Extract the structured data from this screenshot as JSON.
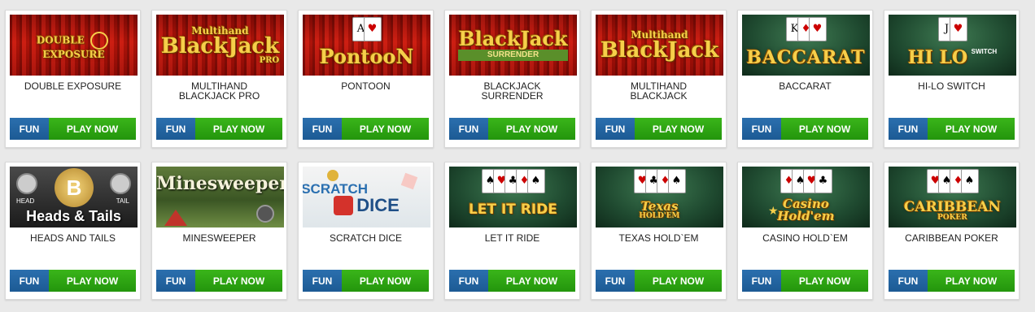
{
  "buttons": {
    "fun": "FUN",
    "play": "PLAY NOW"
  },
  "games": [
    {
      "title": "DOUBLE EXPOSURE",
      "logo_lines": [
        "DOUBLE",
        "EXPOSURE"
      ]
    },
    {
      "title": "MULTIHAND\nBLACKJACK PRO",
      "logo_lines": [
        "Multihand",
        "BlackJack",
        "PRO"
      ]
    },
    {
      "title": "PONTOON",
      "logo_lines": [
        "PontooN"
      ]
    },
    {
      "title": "BLACKJACK\nSURRENDER",
      "logo_lines": [
        "BlackJack",
        "SURRENDER"
      ]
    },
    {
      "title": "MULTIHAND\nBLACKJACK",
      "logo_lines": [
        "Multihand",
        "BlackJack"
      ]
    },
    {
      "title": "BACCARAT",
      "logo_lines": [
        "BACCARAT"
      ]
    },
    {
      "title": "HI-LO SWITCH",
      "logo_lines": [
        "HI LO",
        "SWITCH"
      ]
    },
    {
      "title": "HEADS AND TAILS",
      "logo_lines": [
        "Heads & Tails",
        "HEAD",
        "TAIL"
      ]
    },
    {
      "title": "MINESWEEPER",
      "logo_lines": [
        "Minesweeper"
      ]
    },
    {
      "title": "SCRATCH DICE",
      "logo_lines": [
        "SCRATCH",
        "DICE"
      ]
    },
    {
      "title": "LET IT RIDE",
      "logo_lines": [
        "LET IT RIDE"
      ]
    },
    {
      "title": "TEXAS HOLD`EM",
      "logo_lines": [
        "Texas",
        "HOLD'EM"
      ]
    },
    {
      "title": "CASINO HOLD`EM",
      "logo_lines": [
        "Casino",
        "Hold'em"
      ]
    },
    {
      "title": "CARIBBEAN POKER",
      "logo_lines": [
        "CARIBBEAN",
        "POKER"
      ]
    }
  ]
}
